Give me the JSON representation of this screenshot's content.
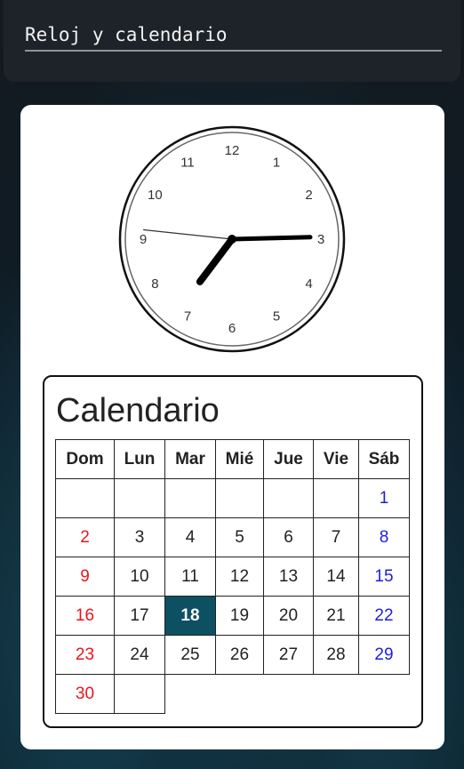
{
  "app": {
    "title": "Reloj y calendario"
  },
  "clock": {
    "numbers": [
      "12",
      "1",
      "2",
      "3",
      "4",
      "5",
      "6",
      "7",
      "8",
      "9",
      "10",
      "11"
    ],
    "time": {
      "hour": 7,
      "minute": 14,
      "second": 46
    }
  },
  "calendar": {
    "title": "Calendario",
    "days": [
      "Dom",
      "Lun",
      "Mar",
      "Mié",
      "Jue",
      "Vie",
      "Sáb"
    ],
    "weeks": [
      [
        "",
        "",
        "",
        "",
        "",
        "",
        "1"
      ],
      [
        "2",
        "3",
        "4",
        "5",
        "6",
        "7",
        "8"
      ],
      [
        "9",
        "10",
        "11",
        "12",
        "13",
        "14",
        "15"
      ],
      [
        "16",
        "17",
        "18",
        "19",
        "20",
        "21",
        "22"
      ],
      [
        "23",
        "24",
        "25",
        "26",
        "27",
        "28",
        "29"
      ],
      [
        "30",
        ""
      ]
    ],
    "today": "18",
    "colors": {
      "sunday": "#e8151b",
      "saturday": "#2020d8",
      "today_bg": "#0d5062"
    }
  }
}
